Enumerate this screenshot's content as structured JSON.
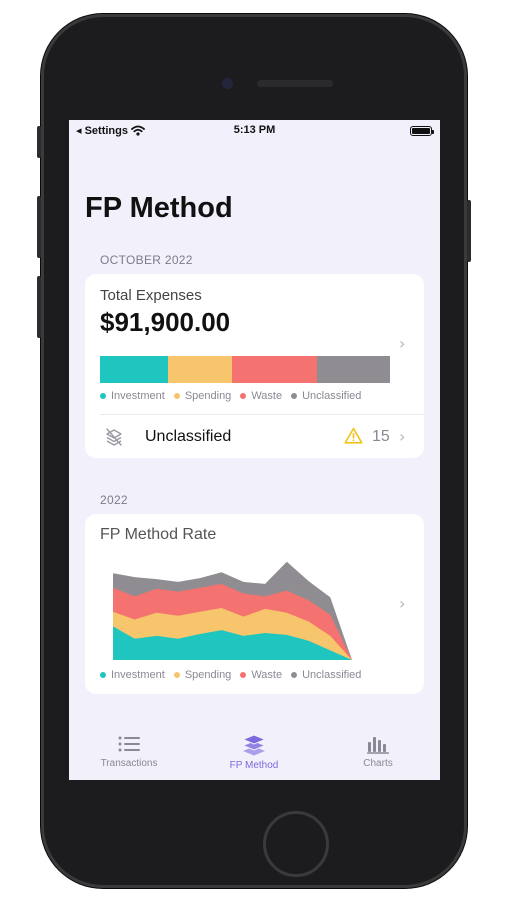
{
  "status_bar": {
    "back_label": "◂ Settings",
    "time": "5:13 PM"
  },
  "page": {
    "title": "FP Method"
  },
  "expenses_section": {
    "period_label": "OCTOBER 2022",
    "total_label": "Total Expenses",
    "total_amount": "$91,900.00",
    "breakdown": [
      {
        "name": "Investment",
        "share": 0.235,
        "color": "#1fc6bf"
      },
      {
        "name": "Spending",
        "share": 0.22,
        "color": "#f7c56b"
      },
      {
        "name": "Waste",
        "share": 0.295,
        "color": "#f4726f"
      },
      {
        "name": "Unclassified",
        "share": 0.25,
        "color": "#8f8d91"
      }
    ],
    "unclassified_row": {
      "label": "Unclassified",
      "count": "15"
    }
  },
  "rate_section": {
    "year_label": "2022",
    "title": "FP Method Rate",
    "chart_data": {
      "type": "area",
      "stacked": true,
      "normalized": false,
      "x": [
        1,
        2,
        3,
        4,
        5,
        6,
        7,
        8,
        9,
        10,
        11,
        12
      ],
      "series": [
        {
          "name": "Investment",
          "color": "#1fc6bf",
          "values": [
            35,
            22,
            25,
            22,
            27,
            31,
            25,
            28,
            26,
            20,
            10,
            0
          ]
        },
        {
          "name": "Spending",
          "color": "#f7c56b",
          "values": [
            15,
            20,
            24,
            24,
            23,
            23,
            20,
            25,
            23,
            20,
            15,
            0
          ]
        },
        {
          "name": "Waste",
          "color": "#f4726f",
          "values": [
            25,
            24,
            25,
            25,
            25,
            25,
            24,
            13,
            23,
            22,
            22,
            0
          ]
        },
        {
          "name": "Unclassified",
          "color": "#8f8d91",
          "values": [
            15,
            20,
            10,
            10,
            10,
            12,
            12,
            13,
            30,
            20,
            18,
            0
          ]
        }
      ],
      "ylim": [
        0,
        110
      ],
      "grid": false,
      "legend": "bottom"
    }
  },
  "tab_bar": {
    "tabs": [
      {
        "label": "Transactions",
        "icon": "list-icon",
        "active": false
      },
      {
        "label": "FP Method",
        "icon": "layers-icon",
        "active": true
      },
      {
        "label": "Charts",
        "icon": "bar-chart-icon",
        "active": false
      }
    ],
    "active_color": "#7b6bdc",
    "inactive_color": "#8a8894"
  }
}
